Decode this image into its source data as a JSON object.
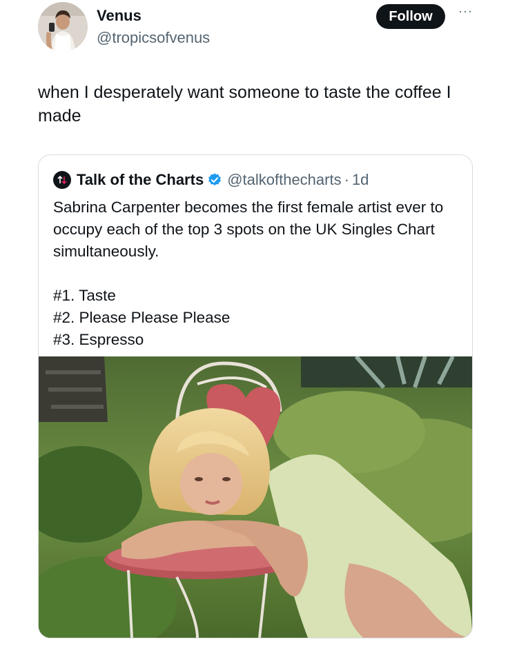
{
  "tweet": {
    "display_name": "Venus",
    "handle": "@tropicsofvenus",
    "follow_label": "Follow",
    "more_icon": "ellipsis-icon",
    "text": "when I desperately want someone to taste the coffee I made"
  },
  "quote": {
    "avatar_icon": "chart-arrows-icon",
    "display_name": "Talk of the Charts",
    "verified_icon": "verified-badge-icon",
    "handle": "@talkofthecharts",
    "separator": "·",
    "time": "1d",
    "body": "Sabrina Carpenter becomes the first female artist ever to occupy each of the top 3 spots on the UK Singles Chart simultaneously.",
    "list": [
      "#1. Taste",
      "#2. Please Please Please",
      "#3. Espresso"
    ]
  },
  "colors": {
    "text": "#0f1419",
    "secondary": "#536471",
    "verified": "#1d9bf0",
    "border": "#d8dde1"
  }
}
